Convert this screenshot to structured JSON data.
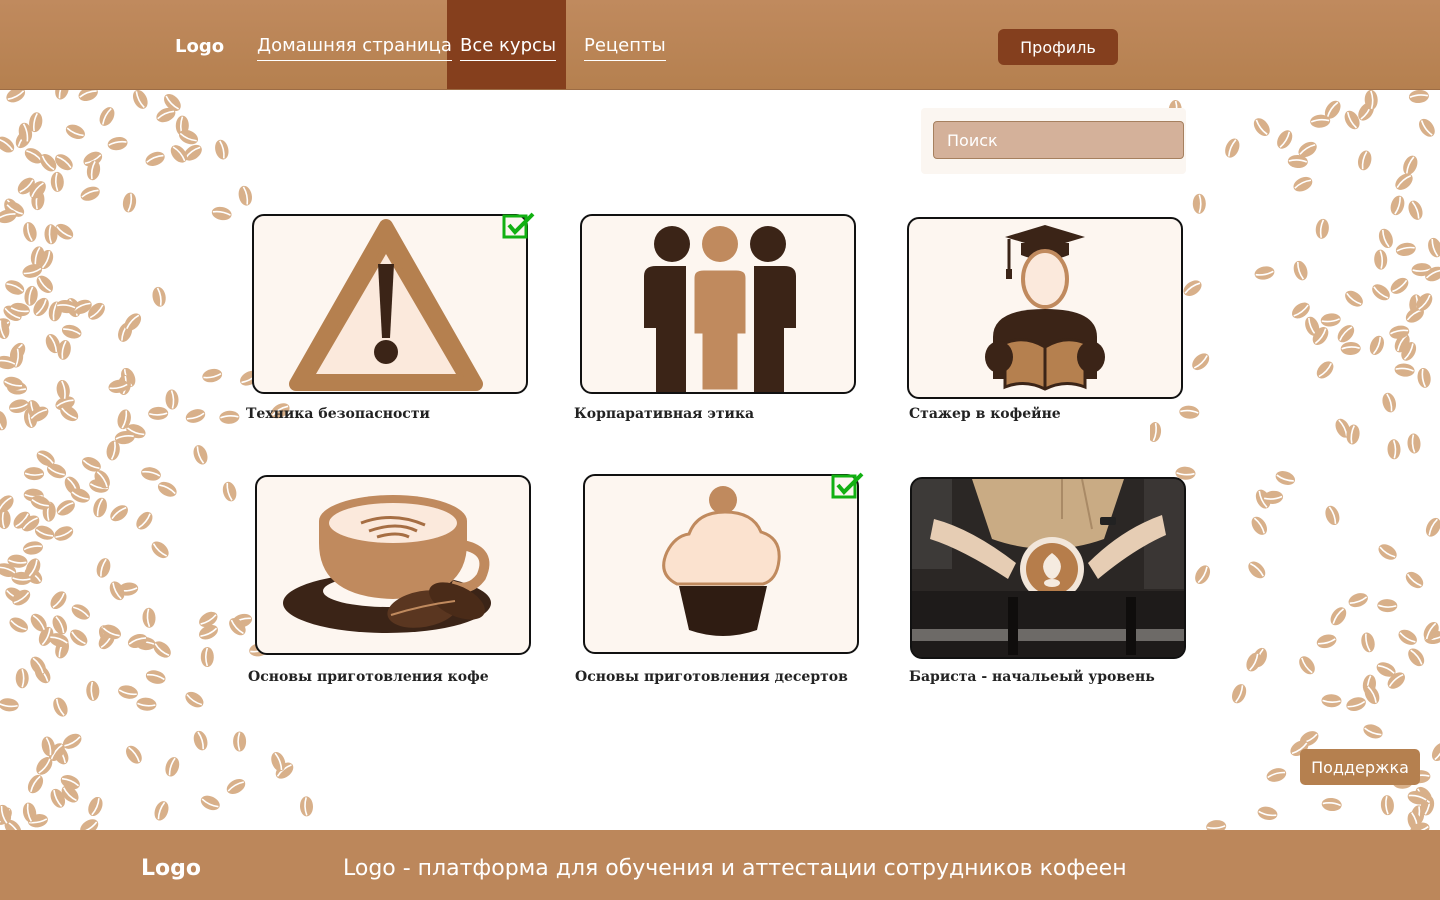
{
  "nav": {
    "logo": "Logo",
    "links": [
      {
        "label": "Домашняя страница"
      },
      {
        "label": "Все курсы",
        "active": true
      },
      {
        "label": "Рецепты"
      }
    ],
    "profile_label": "Профиль"
  },
  "search": {
    "placeholder": "Поиск"
  },
  "courses": [
    {
      "title": "Техника безопасности",
      "icon": "warning-icon",
      "completed": true
    },
    {
      "title": "Корпаративная этика",
      "icon": "team-icon",
      "completed": false
    },
    {
      "title": "Стажер в кофейне",
      "icon": "graduate-reading-icon",
      "completed": false
    },
    {
      "title": "Основы приготовления кофе",
      "icon": "coffee-cup-icon",
      "completed": false
    },
    {
      "title": "Основы приготовления десертов",
      "icon": "cupcake-icon",
      "completed": true
    },
    {
      "title": "Бариста - начальеый уровень",
      "icon": "barista-latte-photo",
      "completed": false
    }
  ],
  "support_label": "Поддержка",
  "footer": {
    "logo": "Logo",
    "tagline": "Logo - платформа для обучения и аттестации сотрудников кофеен"
  },
  "colors": {
    "header": "#bc875b",
    "active_nav": "#853f1d",
    "profile_button": "#843f1e",
    "search_field": "#d4b19a",
    "check_green": "#12b012",
    "bean": "#d8b08a"
  }
}
